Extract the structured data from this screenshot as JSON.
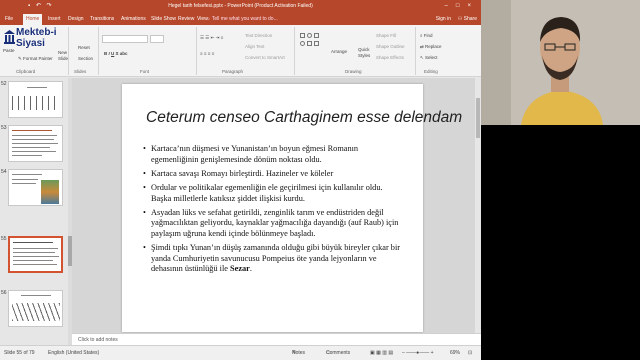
{
  "window": {
    "title": "Hegel tarih felsefesi.pptx - PowerPoint (Product Activation Failed)",
    "qat_icons": [
      "save-icon",
      "undo-icon",
      "redo-icon"
    ]
  },
  "tabs": [
    "File",
    "Home",
    "Insert",
    "Design",
    "Transitions",
    "Animations",
    "Slide Show",
    "Review",
    "View"
  ],
  "tell_me": "Tell me what you want to do...",
  "account": {
    "sign_in": "Sign in",
    "share": "Share"
  },
  "logo": {
    "line1": "Mekteb-i",
    "line2": "Siyasi"
  },
  "ribbon": {
    "clipboard": {
      "label": "Clipboard",
      "paste": "Paste",
      "format_painter": "Format Painter"
    },
    "slides": {
      "label": "Slides",
      "new_slide_1": "New",
      "new_slide_2": "Slide",
      "reset": "Reset",
      "section": "Section"
    },
    "font": {
      "label": "Font"
    },
    "paragraph": {
      "label": "Paragraph",
      "text_direction": "Text Direction",
      "align_text": "Align Text",
      "convert_smartart": "Convert to SmartArt"
    },
    "drawing": {
      "label": "Drawing",
      "arrange": "Arrange",
      "quick_styles_1": "Quick",
      "quick_styles_2": "Styles",
      "shape_fill": "Shape Fill",
      "shape_outline": "Shape Outline",
      "shape_effects": "Shape Effects"
    },
    "editing": {
      "label": "Editing",
      "find": "Find",
      "replace": "Replace",
      "select": "Select"
    }
  },
  "thumbnails": [
    {
      "num": "52",
      "active": false
    },
    {
      "num": "53",
      "active": false
    },
    {
      "num": "54",
      "active": false
    },
    {
      "num": "55",
      "active": true
    },
    {
      "num": "56",
      "active": false
    }
  ],
  "slide": {
    "title": "Ceterum censeo Carthaginem esse delendam",
    "bullets": [
      "Kartaca’nın düşmesi ve Yunanistan’ın boyun eğmesi Romanın egemenliğinin genişlemesinde dönüm noktası oldu.",
      "Kartaca savaşı Romayı birleştirdi. Hazineler ve köleler",
      "Ordular ve politikalar egemenliğin ele geçirilmesi için kullanılır oldu. Başka milletlerle katıksız şiddet ilişkisi kurdu.",
      "Asyadan lüks ve sefahat getirildi, zenginlik tarım ve endüstriden değil yağmacılıktan geliyordu, kaynaklar yağmacılığa dayandığı (auf Raub) için paylaşım uğruna kendi içinde bölünmeye başladı."
    ],
    "last_bullet_before": "Şimdi tıpkı Yunan’ın düşüş zamanında olduğu gibi büyük bireyler çıkar bir yanda Cumhuriyetin savunucusu Pompeius öte yanda lejyonların ve dehasının üstünlüğü ile ",
    "last_bullet_bold": "Sezar",
    "last_bullet_after": "."
  },
  "notes_placeholder": "Click to add notes",
  "status": {
    "slide_info": "Slide 55 of 79",
    "language": "English (United States)",
    "notes": "Notes",
    "comments": "Comments",
    "zoom": "69%"
  }
}
